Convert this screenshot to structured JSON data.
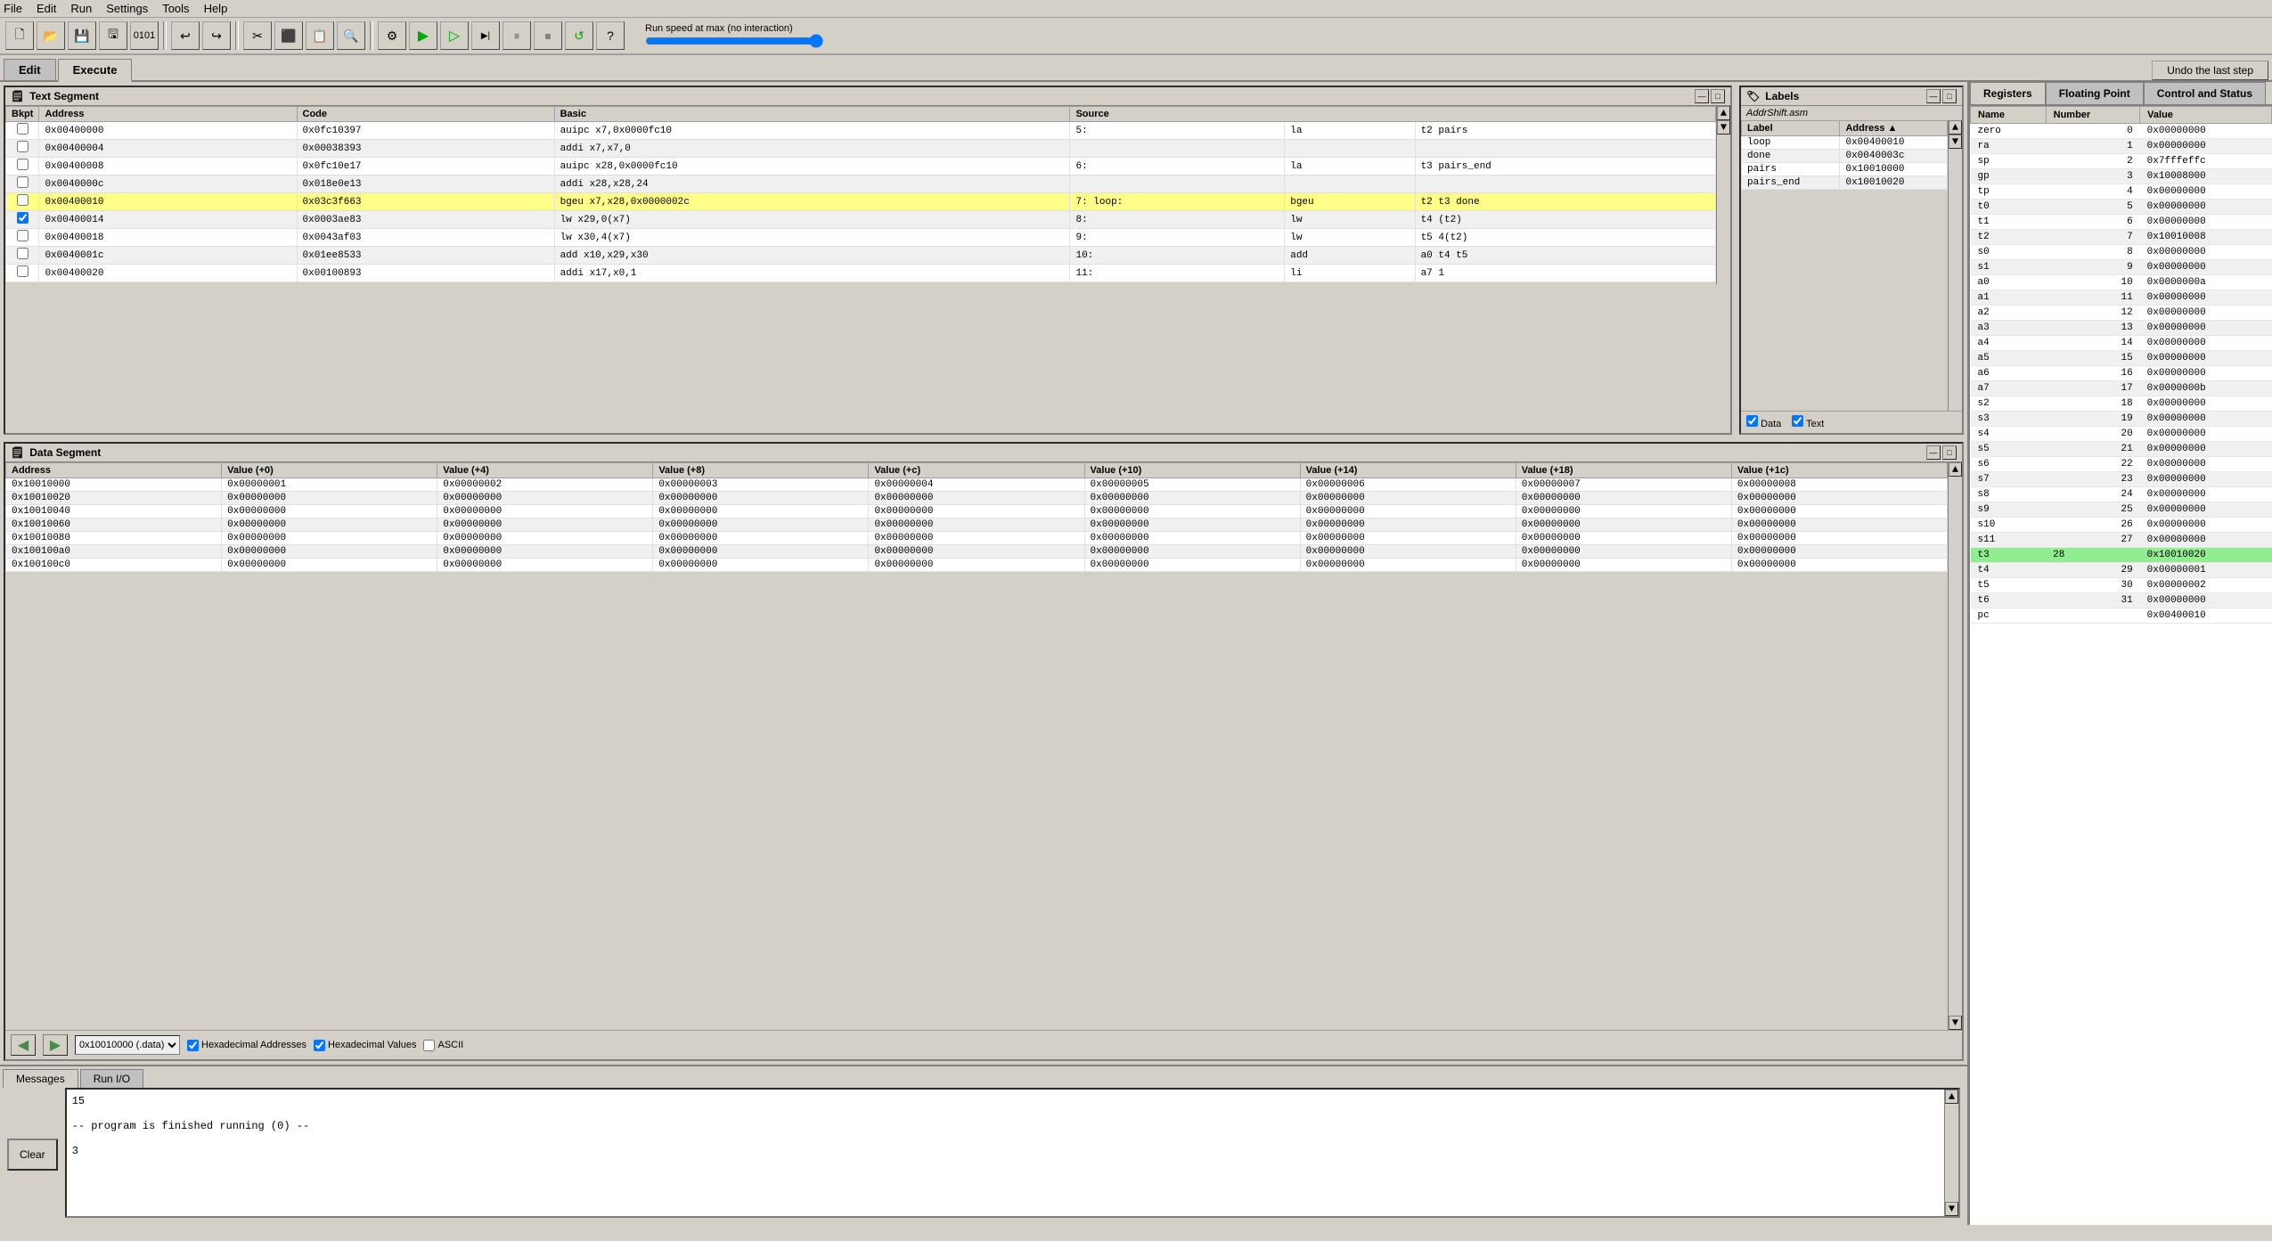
{
  "menubar": {
    "items": [
      "File",
      "Edit",
      "Run",
      "Settings",
      "Tools",
      "Help"
    ]
  },
  "toolbar": {
    "speed_label": "Run speed at max (no interaction)"
  },
  "tabs": {
    "edit_label": "Edit",
    "execute_label": "Execute",
    "active": "Execute"
  },
  "undo_btn": "Undo the last step",
  "text_segment": {
    "title": "Text Segment",
    "columns": [
      "Bkpt",
      "Address",
      "Code",
      "Basic",
      "Source"
    ],
    "rows": [
      {
        "bkpt": false,
        "address": "0x00400000",
        "code": "0x0fc10397",
        "basic": "auipc x7,0x0000fc10",
        "src_num": "5:",
        "src_op": "la",
        "src_args": "t2 pairs"
      },
      {
        "bkpt": false,
        "address": "0x00400004",
        "code": "0x00038393",
        "basic": "addi x7,x7,0",
        "src_num": "",
        "src_op": "",
        "src_args": ""
      },
      {
        "bkpt": false,
        "address": "0x00400008",
        "code": "0x0fc10e17",
        "basic": "auipc x28,0x0000fc10",
        "src_num": "6:",
        "src_op": "la",
        "src_args": "t3 pairs_end"
      },
      {
        "bkpt": false,
        "address": "0x0040000c",
        "code": "0x018e0e13",
        "basic": "addi x28,x28,24",
        "src_num": "",
        "src_op": "",
        "src_args": ""
      },
      {
        "bkpt": false,
        "address": "0x00400010",
        "code": "0x03c3f663",
        "basic": "bgeu x7,x28,0x0000002c",
        "src_num": "7: loop:",
        "src_op": "bgeu",
        "src_args": "t2 t3 done",
        "highlight": true
      },
      {
        "bkpt": true,
        "address": "0x00400014",
        "code": "0x0003ae83",
        "basic": "lw x29,0(x7)",
        "src_num": "8:",
        "src_op": "lw",
        "src_args": "t4 (t2)"
      },
      {
        "bkpt": false,
        "address": "0x00400018",
        "code": "0x0043af03",
        "basic": "lw x30,4(x7)",
        "src_num": "9:",
        "src_op": "lw",
        "src_args": "t5 4(t2)"
      },
      {
        "bkpt": false,
        "address": "0x0040001c",
        "code": "0x01ee8533",
        "basic": "add x10,x29,x30",
        "src_num": "10:",
        "src_op": "add",
        "src_args": "a0 t4 t5"
      },
      {
        "bkpt": false,
        "address": "0x00400020",
        "code": "0x00100893",
        "basic": "addi x17,x0,1",
        "src_num": "11:",
        "src_op": "li",
        "src_args": "a7 1"
      }
    ]
  },
  "labels": {
    "title": "Labels",
    "file": "AddrShift.asm",
    "columns": [
      "Label",
      "Address ▲"
    ],
    "rows": [
      {
        "label": "loop",
        "address": "0x00400010"
      },
      {
        "label": "done",
        "address": "0x0040003c"
      },
      {
        "label": "pairs",
        "address": "0x10010000"
      },
      {
        "label": "pairs_end",
        "address": "0x10010020"
      }
    ],
    "check_data": "Data",
    "check_text": "Text"
  },
  "data_segment": {
    "title": "Data Segment",
    "columns": [
      "Address",
      "Value (+0)",
      "Value (+4)",
      "Value (+8)",
      "Value (+c)",
      "Value (+10)",
      "Value (+14)",
      "Value (+18)",
      "Value (+1c)"
    ],
    "rows": [
      {
        "addr": "0x10010000",
        "v0": "0x00000001",
        "v4": "0x00000002",
        "v8": "0x00000003",
        "vc": "0x00000004",
        "v10": "0x00000005",
        "v14": "0x00000006",
        "v18": "0x00000007",
        "v1c": "0x00000008"
      },
      {
        "addr": "0x10010020",
        "v0": "0x00000000",
        "v4": "0x00000000",
        "v8": "0x00000000",
        "vc": "0x00000000",
        "v10": "0x00000000",
        "v14": "0x00000000",
        "v18": "0x00000000",
        "v1c": "0x00000000"
      },
      {
        "addr": "0x10010040",
        "v0": "0x00000000",
        "v4": "0x00000000",
        "v8": "0x00000000",
        "vc": "0x00000000",
        "v10": "0x00000000",
        "v14": "0x00000000",
        "v18": "0x00000000",
        "v1c": "0x00000000"
      },
      {
        "addr": "0x10010060",
        "v0": "0x00000000",
        "v4": "0x00000000",
        "v8": "0x00000000",
        "vc": "0x00000000",
        "v10": "0x00000000",
        "v14": "0x00000000",
        "v18": "0x00000000",
        "v1c": "0x00000000"
      },
      {
        "addr": "0x10010080",
        "v0": "0x00000000",
        "v4": "0x00000000",
        "v8": "0x00000000",
        "vc": "0x00000000",
        "v10": "0x00000000",
        "v14": "0x00000000",
        "v18": "0x00000000",
        "v1c": "0x00000000"
      },
      {
        "addr": "0x100100a0",
        "v0": "0x00000000",
        "v4": "0x00000000",
        "v8": "0x00000000",
        "vc": "0x00000000",
        "v10": "0x00000000",
        "v14": "0x00000000",
        "v18": "0x00000000",
        "v1c": "0x00000000"
      },
      {
        "addr": "0x100100c0",
        "v0": "0x00000000",
        "v4": "0x00000000",
        "v8": "0x00000000",
        "vc": "0x00000000",
        "v10": "0x00000000",
        "v14": "0x00000000",
        "v18": "0x00000000",
        "v1c": "0x00000000"
      }
    ],
    "seg_select": "0x10010000 (.data)",
    "check_hex_addr": "Hexadecimal Addresses",
    "check_hex_val": "Hexadecimal Values",
    "check_ascii": "ASCII"
  },
  "messages": {
    "tabs": [
      "Messages",
      "Run I/O"
    ],
    "active_tab": "Messages",
    "content": "15\n\n-- program is finished running (0) --\n\n3",
    "clear_label": "Clear"
  },
  "registers": {
    "tabs": [
      "Registers",
      "Floating Point",
      "Control and Status"
    ],
    "active_tab": "Registers",
    "columns": [
      "Name",
      "Number",
      "Value"
    ],
    "rows": [
      {
        "name": "zero",
        "number": "0",
        "value": "0x00000000"
      },
      {
        "name": "ra",
        "number": "1",
        "value": "0x00000000"
      },
      {
        "name": "sp",
        "number": "2",
        "value": "0x7fffeffc"
      },
      {
        "name": "gp",
        "number": "3",
        "value": "0x10008000"
      },
      {
        "name": "tp",
        "number": "4",
        "value": "0x00000000"
      },
      {
        "name": "t0",
        "number": "5",
        "value": "0x00000000"
      },
      {
        "name": "t1",
        "number": "6",
        "value": "0x00000000"
      },
      {
        "name": "t2",
        "number": "7",
        "value": "0x10010008"
      },
      {
        "name": "s0",
        "number": "8",
        "value": "0x00000000"
      },
      {
        "name": "s1",
        "number": "9",
        "value": "0x00000000"
      },
      {
        "name": "a0",
        "number": "10",
        "value": "0x0000000a"
      },
      {
        "name": "a1",
        "number": "11",
        "value": "0x00000000"
      },
      {
        "name": "a2",
        "number": "12",
        "value": "0x00000000"
      },
      {
        "name": "a3",
        "number": "13",
        "value": "0x00000000"
      },
      {
        "name": "a4",
        "number": "14",
        "value": "0x00000000"
      },
      {
        "name": "a5",
        "number": "15",
        "value": "0x00000000"
      },
      {
        "name": "a6",
        "number": "16",
        "value": "0x00000000"
      },
      {
        "name": "a7",
        "number": "17",
        "value": "0x0000000b"
      },
      {
        "name": "s2",
        "number": "18",
        "value": "0x00000000"
      },
      {
        "name": "s3",
        "number": "19",
        "value": "0x00000000"
      },
      {
        "name": "s4",
        "number": "20",
        "value": "0x00000000"
      },
      {
        "name": "s5",
        "number": "21",
        "value": "0x00000000"
      },
      {
        "name": "s6",
        "number": "22",
        "value": "0x00000000"
      },
      {
        "name": "s7",
        "number": "23",
        "value": "0x00000000"
      },
      {
        "name": "s8",
        "number": "24",
        "value": "0x00000000"
      },
      {
        "name": "s9",
        "number": "25",
        "value": "0x00000000"
      },
      {
        "name": "s10",
        "number": "26",
        "value": "0x00000000"
      },
      {
        "name": "s11",
        "number": "27",
        "value": "0x00000000"
      },
      {
        "name": "t3",
        "number": "28",
        "value": "0x10010020",
        "highlight": true
      },
      {
        "name": "t4",
        "number": "29",
        "value": "0x00000001"
      },
      {
        "name": "t5",
        "number": "30",
        "value": "0x00000002"
      },
      {
        "name": "t6",
        "number": "31",
        "value": "0x00000000"
      },
      {
        "name": "pc",
        "number": "",
        "value": "0x00400010"
      }
    ]
  }
}
